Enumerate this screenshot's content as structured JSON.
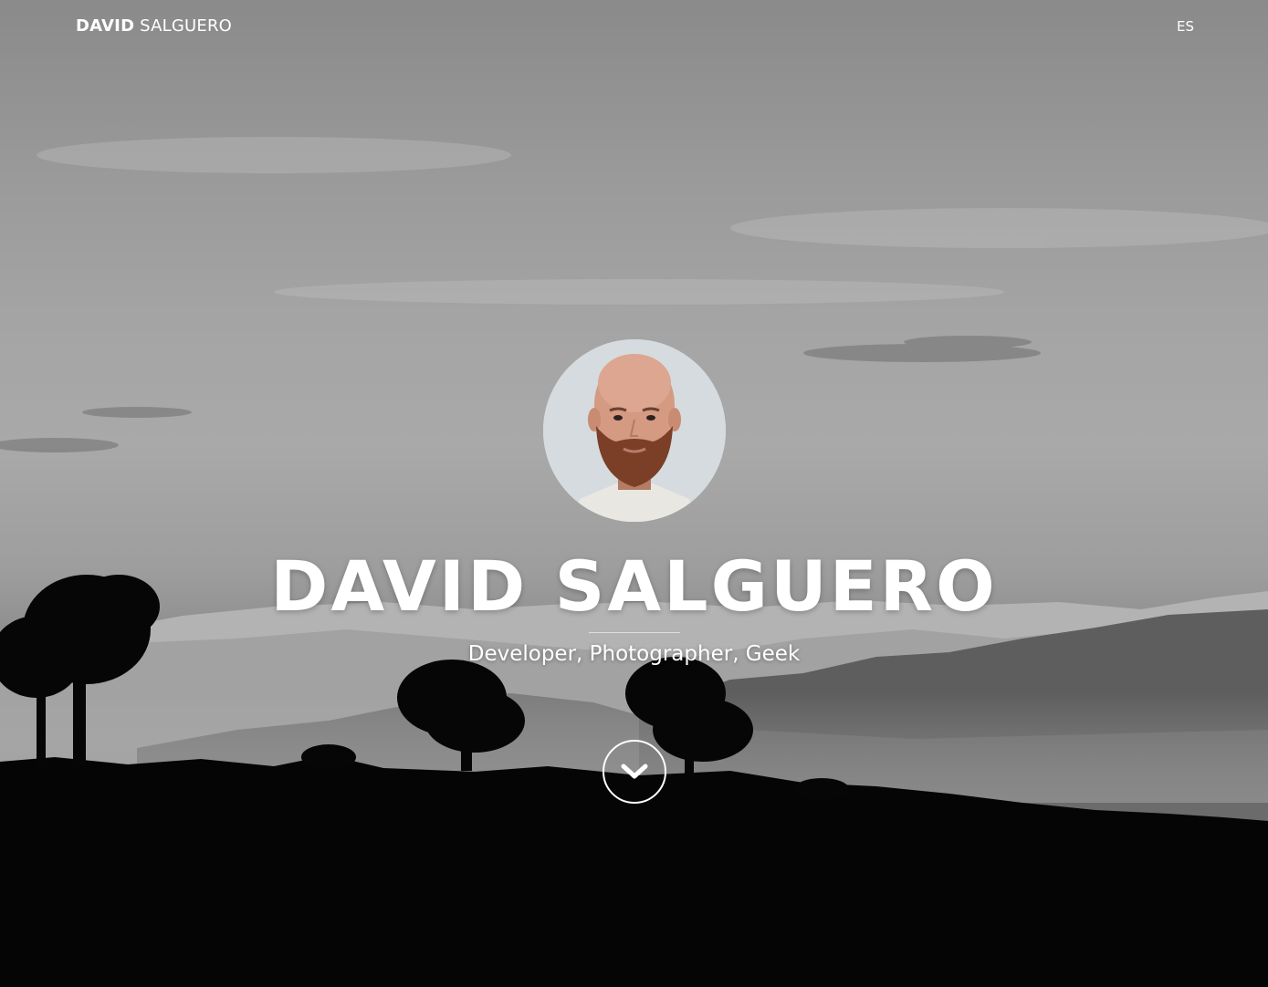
{
  "navbar": {
    "brand_bold": "DAVID",
    "brand_rest": "SALGUERO",
    "language_link": "ES"
  },
  "hero": {
    "title": "DAVID SALGUERO",
    "subtitle": "Developer, Photographer, Geek",
    "avatar_icon": "profile-photo",
    "scroll_icon": "chevron-down-icon"
  },
  "colors": {
    "text": "#ffffff",
    "background_dark": "#000000"
  }
}
